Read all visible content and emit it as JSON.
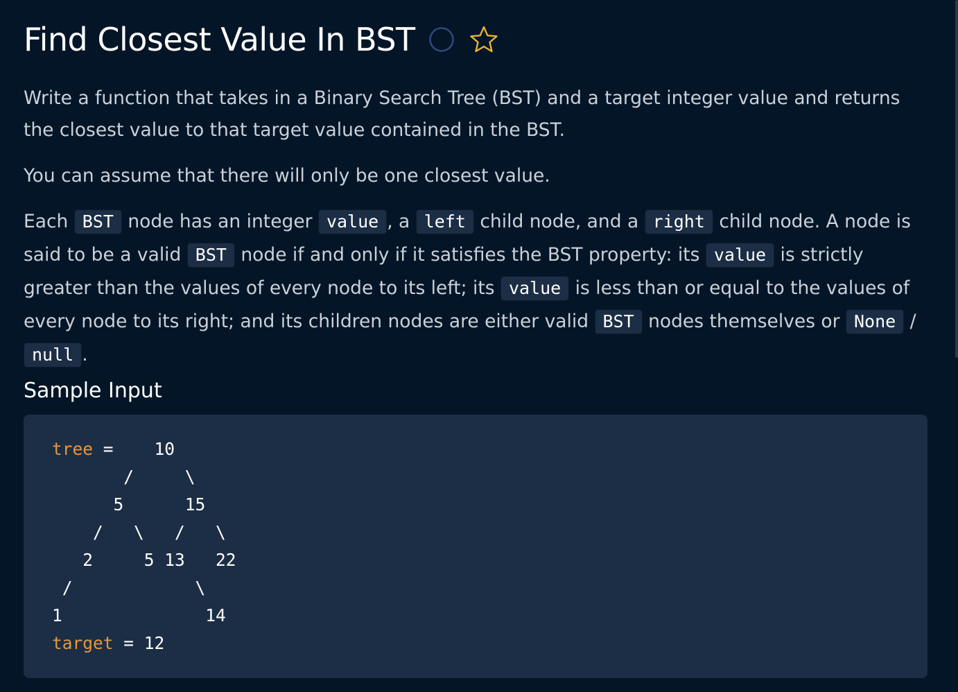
{
  "problem": {
    "title": "Find Closest Value In BST",
    "status_icon": "circle-outline-icon",
    "favorite_icon": "star-outline-icon",
    "accent_color": "#e8b339",
    "status_color": "#2f4a7a"
  },
  "description": {
    "p1": "Write a function that takes in a Binary Search Tree (BST) and a target integer value and returns the closest value to that target value contained in the BST.",
    "p2": "You can assume that there will only be one closest value.",
    "p3": {
      "t1": "Each ",
      "c1": "BST",
      "t2": " node has an integer ",
      "c2": "value",
      "t3": ", a ",
      "c3": "left",
      "t4": " child node, and a ",
      "c4": "right",
      "t5": " child node. A node is said to be a valid ",
      "c5": "BST",
      "t6": " node if and only if it satisfies the BST property: its ",
      "c6": "value",
      "t7": " is strictly greater than the values of every node to its left; its ",
      "c7": "value",
      "t8": " is less than or equal to the values of every node to its right; and its children nodes are either valid ",
      "c8": "BST",
      "t9": " nodes themselves or ",
      "c9": "None",
      "t10": " / ",
      "c10": "null",
      "t11": "."
    }
  },
  "sample_input": {
    "heading": "Sample Input",
    "tree_keyword": "tree",
    "tree_assign": " =    10",
    "lines": [
      "       /     \\",
      "      5      15",
      "    /   \\   /   \\",
      "   2     5 13   22",
      " /            \\",
      "1              14"
    ],
    "target_keyword": "target",
    "target_assign": " = 12"
  }
}
